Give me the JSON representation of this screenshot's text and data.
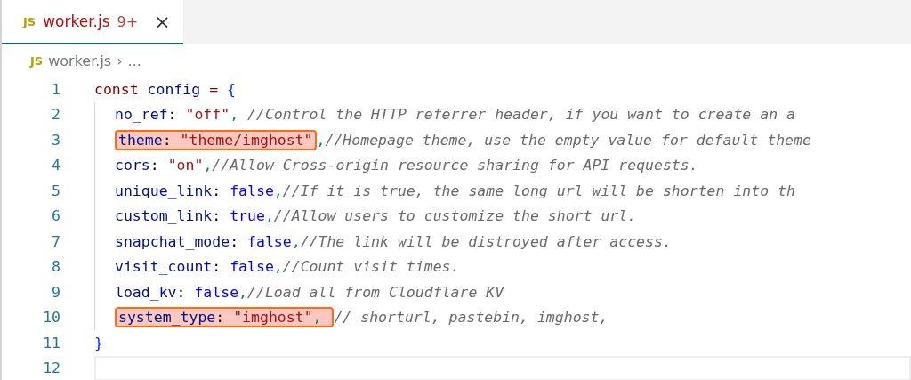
{
  "tabs": [
    {
      "icon_text": "JS",
      "label": "worker.js",
      "problems": "9+",
      "close": "×",
      "selected": true
    }
  ],
  "breadcrumb": {
    "icon_text": "JS",
    "file": "worker.js",
    "separator": "›",
    "rest": "..."
  },
  "lines": [
    {
      "number": "1",
      "indented": false,
      "current": false,
      "tokens": [
        {
          "kind": "keyword",
          "text": "const "
        },
        {
          "kind": "name",
          "text": "config"
        },
        {
          "kind": "keyword",
          "text": " = "
        },
        {
          "kind": "brace",
          "text": "{"
        }
      ]
    },
    {
      "number": "2",
      "indented": true,
      "current": false,
      "tokens": [
        {
          "kind": "key",
          "text": "no_ref"
        },
        {
          "kind": "plain",
          "text": ": "
        },
        {
          "kind": "string",
          "text": "\"off\""
        },
        {
          "kind": "comma",
          "text": ", "
        },
        {
          "kind": "comment",
          "text": "//Control the HTTP referrer header, if you want to create an a"
        }
      ]
    },
    {
      "number": "3",
      "indented": true,
      "current": false,
      "marked": [
        {
          "kind": "key",
          "text": "theme"
        },
        {
          "kind": "plain",
          "text": ": "
        },
        {
          "kind": "string",
          "text": "\"theme/imghost\""
        }
      ],
      "tokens": [
        {
          "kind": "comma",
          "text": ","
        },
        {
          "kind": "comment",
          "text": "//Homepage theme, use the empty value for default theme"
        }
      ]
    },
    {
      "number": "4",
      "indented": true,
      "current": false,
      "tokens": [
        {
          "kind": "key",
          "text": "cors"
        },
        {
          "kind": "plain",
          "text": ": "
        },
        {
          "kind": "string",
          "text": "\"on\""
        },
        {
          "kind": "comma",
          "text": ","
        },
        {
          "kind": "comment",
          "text": "//Allow Cross-origin resource sharing for API requests."
        }
      ]
    },
    {
      "number": "5",
      "indented": true,
      "current": false,
      "tokens": [
        {
          "kind": "key",
          "text": "unique_link"
        },
        {
          "kind": "plain",
          "text": ": "
        },
        {
          "kind": "bool",
          "text": "false"
        },
        {
          "kind": "comma",
          "text": ","
        },
        {
          "kind": "comment",
          "text": "//If it is true, the same long url will be shorten into th"
        }
      ]
    },
    {
      "number": "6",
      "indented": true,
      "current": false,
      "tokens": [
        {
          "kind": "key",
          "text": "custom_link"
        },
        {
          "kind": "plain",
          "text": ": "
        },
        {
          "kind": "bool",
          "text": "true"
        },
        {
          "kind": "comma",
          "text": ","
        },
        {
          "kind": "comment",
          "text": "//Allow users to customize the short url."
        }
      ]
    },
    {
      "number": "7",
      "indented": true,
      "current": false,
      "tokens": [
        {
          "kind": "key",
          "text": "snapchat_mode"
        },
        {
          "kind": "plain",
          "text": ": "
        },
        {
          "kind": "bool",
          "text": "false"
        },
        {
          "kind": "comma",
          "text": ","
        },
        {
          "kind": "comment",
          "text": "//The link will be distroyed after access."
        }
      ]
    },
    {
      "number": "8",
      "indented": true,
      "current": false,
      "tokens": [
        {
          "kind": "key",
          "text": "visit_count"
        },
        {
          "kind": "plain",
          "text": ": "
        },
        {
          "kind": "bool",
          "text": "false"
        },
        {
          "kind": "comma",
          "text": ","
        },
        {
          "kind": "comment",
          "text": "//Count visit times."
        }
      ]
    },
    {
      "number": "9",
      "indented": true,
      "current": false,
      "tokens": [
        {
          "kind": "key",
          "text": "load_kv"
        },
        {
          "kind": "plain",
          "text": ": "
        },
        {
          "kind": "bool",
          "text": "false"
        },
        {
          "kind": "comma",
          "text": ","
        },
        {
          "kind": "comment",
          "text": "//Load all from Cloudflare KV"
        }
      ]
    },
    {
      "number": "10",
      "indented": true,
      "current": false,
      "marked": [
        {
          "kind": "key",
          "text": "system_type"
        },
        {
          "kind": "plain",
          "text": ": "
        },
        {
          "kind": "string",
          "text": "\"imghost\""
        },
        {
          "kind": "comma",
          "text": ", "
        }
      ],
      "tokens": [
        {
          "kind": "comment",
          "text": "// shorturl, pastebin, imghost,"
        }
      ]
    },
    {
      "number": "11",
      "indented": false,
      "current": false,
      "tokens": [
        {
          "kind": "brace",
          "text": "}"
        }
      ]
    },
    {
      "number": "12",
      "indented": false,
      "current": true
    }
  ]
}
